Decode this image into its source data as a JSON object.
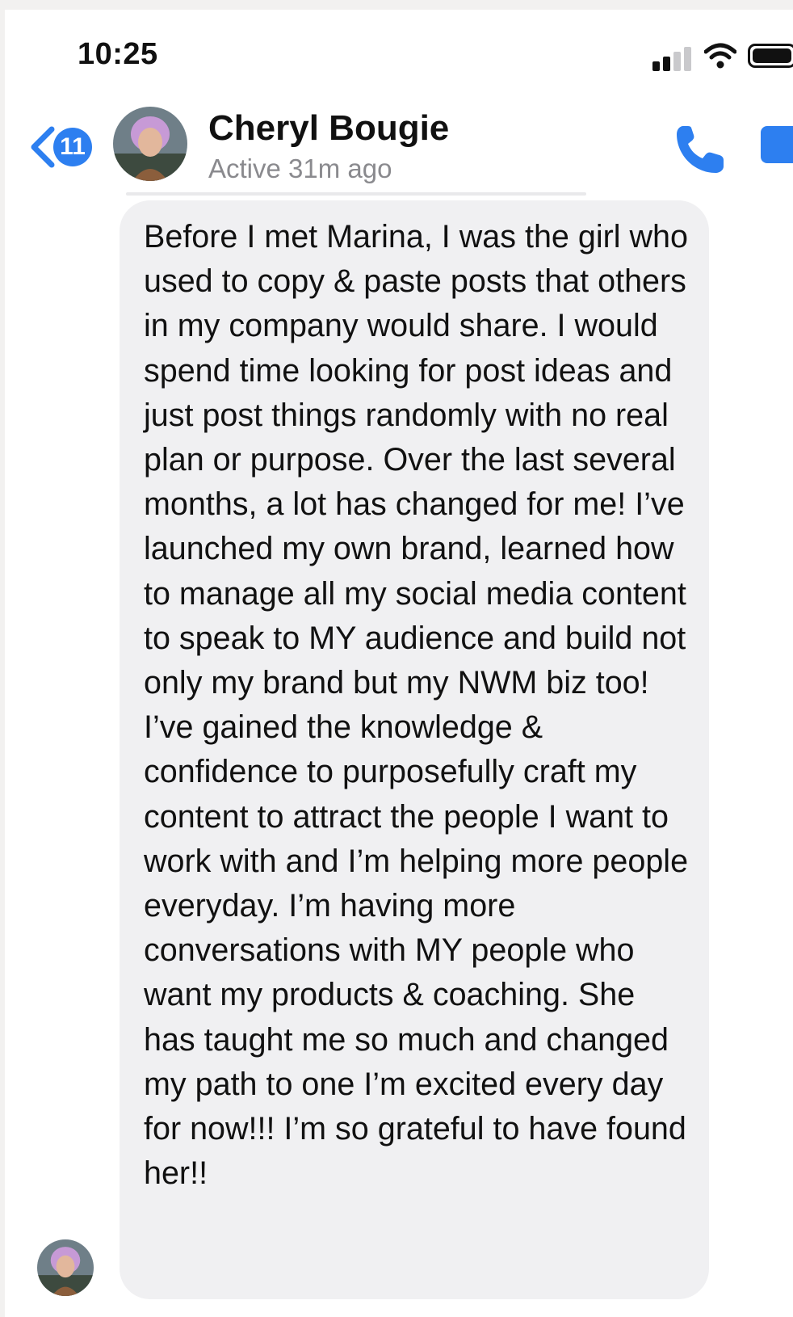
{
  "status_bar": {
    "time": "10:25"
  },
  "header": {
    "back_count": "11",
    "contact_name": "Cheryl Bougie",
    "contact_status": "Active 31m ago",
    "icons": {
      "back": "chevron-left-icon",
      "call": "phone-icon",
      "video": "video-camera-icon",
      "signal": "cellular-signal-icon",
      "wifi": "wifi-icon",
      "battery": "battery-icon"
    }
  },
  "message": {
    "text": "Before I met Marina, I was the girl who used to copy & paste posts that others in my company would share. I would spend time looking for post ideas and just post things randomly with no real plan or purpose. Over the last several months, a lot has changed for me! I’ve launched my own brand, learned how to manage all my social media content to speak to MY audience and build not only my brand but my NWM biz too! I’ve gained the knowledge & confidence to purposefully craft my content to attract the people I want to work with and I’m helping more people everyday. I’m having more conversations with MY people who want my products & coaching. She has taught me so much and changed my path to one I’m excited every day for now!!! I’m so grateful to have found her!!"
  },
  "colors": {
    "accent": "#2d7ff0",
    "bubble": "#f0f0f2",
    "secondary_text": "#8a8a8e"
  }
}
